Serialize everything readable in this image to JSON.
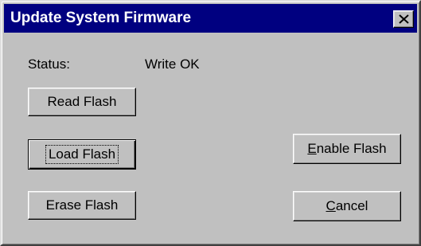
{
  "window": {
    "title": "Update System Firmware"
  },
  "status": {
    "label": "Status:",
    "value": "Write OK"
  },
  "buttons": {
    "read_flash": "Read Flash",
    "load_flash": "Load Flash",
    "erase_flash": "Erase Flash",
    "enable_flash": {
      "mnemonic": "E",
      "rest": "nable Flash"
    },
    "cancel": {
      "mnemonic": "C",
      "rest": "ancel"
    }
  },
  "icons": {
    "close": "close-icon"
  },
  "colors": {
    "titlebar": "#000080",
    "face": "#c0c0c0",
    "title_text": "#ffffff"
  }
}
